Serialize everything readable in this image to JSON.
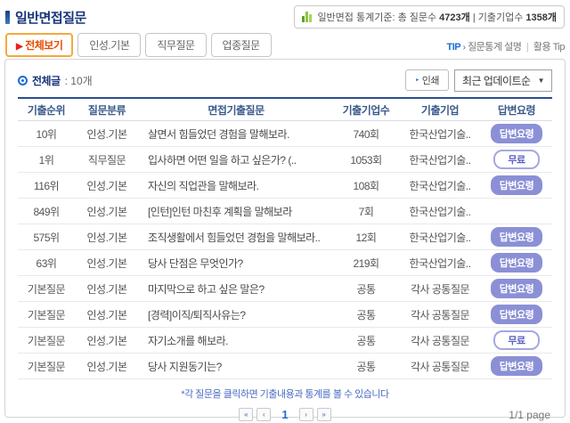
{
  "colors": {
    "accent_navy": "#17357a",
    "tab_active_border": "#f5a93c",
    "tab_active_text": "#e84c00",
    "answer_btn_bg": "#8b90d6",
    "free_btn_border": "#a3a8e0",
    "tip_blue": "#1a6fd4",
    "note_blue": "#4a6cc3",
    "icon_green": "#8dc63f"
  },
  "header": {
    "title": "일반면접질문",
    "stats": {
      "prefix": "일반면접 통계기준: 총 질문수 ",
      "question_count": "4723개",
      "separator": " | 기출기업수 ",
      "company_count": "1358개"
    }
  },
  "tabs": [
    {
      "label": "전체보기",
      "active": true
    },
    {
      "label": "인성.기본",
      "active": false
    },
    {
      "label": "직무질문",
      "active": false
    },
    {
      "label": "업종질문",
      "active": false
    }
  ],
  "tip": {
    "label": "TIP",
    "arrow": "›",
    "link1": "질문통계 설명",
    "divider": "|",
    "link2": "활용 Tip"
  },
  "toolbar": {
    "total_label": "전체글",
    "total_count": ": 10개",
    "print_label": "인쇄",
    "print_arrow": "‣",
    "sort_value": "최근 업데이트순",
    "sort_caret": "▼"
  },
  "table": {
    "columns": {
      "rank": "기출순위",
      "category": "질문분류",
      "question": "면접기출질문",
      "count": "기출기업수",
      "company": "기출기업",
      "action": "답변요령"
    },
    "rows": [
      {
        "rank": "10위",
        "category": "인성.기본",
        "question": "살면서 힘들었던 경험을 말해보라.",
        "count": "740회",
        "company": "한국산업기술..",
        "action": "답변요령",
        "action_type": "filled"
      },
      {
        "rank": "1위",
        "category": "직무질문",
        "question": "입사하면 어떤 일을 하고 싶은가? (..",
        "count": "1053회",
        "company": "한국산업기술..",
        "action": "무료",
        "action_type": "outline"
      },
      {
        "rank": "116위",
        "category": "인성.기본",
        "question": "자신의 직업관을 말해보라.",
        "count": "108회",
        "company": "한국산업기술..",
        "action": "답변요령",
        "action_type": "filled"
      },
      {
        "rank": "849위",
        "category": "인성.기본",
        "question": "[인턴]인턴 마친후 계획을 말해보라",
        "count": "7회",
        "company": "한국산업기술..",
        "action": "",
        "action_type": "none"
      },
      {
        "rank": "575위",
        "category": "인성.기본",
        "question": "조직생활에서 힘들었던 경험을 말해보라..",
        "count": "12회",
        "company": "한국산업기술..",
        "action": "답변요령",
        "action_type": "filled"
      },
      {
        "rank": "63위",
        "category": "인성.기본",
        "question": "당사 단점은 무엇인가?",
        "count": "219회",
        "company": "한국산업기술..",
        "action": "답변요령",
        "action_type": "filled"
      },
      {
        "rank": "기본질문",
        "category": "인성.기본",
        "question": "마지막으로 하고 싶은 말은?",
        "count": "공통",
        "company": "각사 공통질문",
        "action": "답변요령",
        "action_type": "filled"
      },
      {
        "rank": "기본질문",
        "category": "인성.기본",
        "question": "[경력]이직/퇴직사유는?",
        "count": "공통",
        "company": "각사 공통질문",
        "action": "답변요령",
        "action_type": "filled"
      },
      {
        "rank": "기본질문",
        "category": "인성.기본",
        "question": "자기소개를 해보라.",
        "count": "공통",
        "company": "각사 공통질문",
        "action": "무료",
        "action_type": "outline"
      },
      {
        "rank": "기본질문",
        "category": "인성.기본",
        "question": "당사 지원동기는?",
        "count": "공통",
        "company": "각사 공통질문",
        "action": "답변요령",
        "action_type": "filled"
      }
    ]
  },
  "footer": {
    "note": "*각 질문을 클릭하면 기출내용과 통계를 볼 수 있습니다",
    "pagination": {
      "first": "«",
      "prev": "‹",
      "current": "1",
      "next": "›",
      "last": "»"
    },
    "page_info": "1/1 page"
  }
}
